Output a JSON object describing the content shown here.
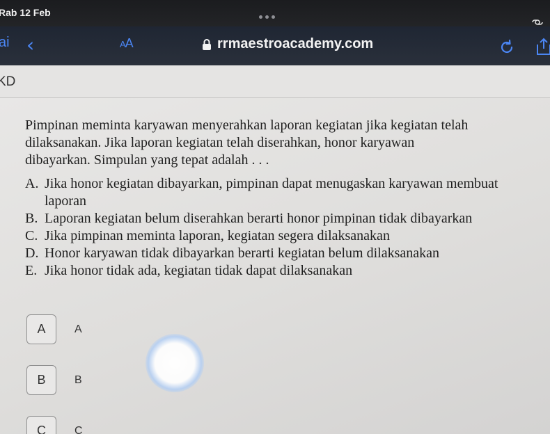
{
  "status_bar": {
    "time": "Rab 12 Feb"
  },
  "toolbar": {
    "tab_fragment": "ai",
    "text_size_label_small": "A",
    "text_size_label_large": "A",
    "url": "rrmaestroacademy.com"
  },
  "page": {
    "header_label": "KD",
    "question_lines": [
      "Pimpinan meminta karyawan menyerahkan laporan kegiatan jika kegiatan telah",
      "dilaksanakan. Jika laporan kegiatan telah diserahkan, honor karyawan",
      "dibayarkan. Simpulan yang tepat adalah . . ."
    ],
    "options": [
      {
        "letter": "A.",
        "text": "Jika honor kegiatan dibayarkan, pimpinan dapat menugaskan karyawan membuat laporan"
      },
      {
        "letter": "B.",
        "text": "Laporan kegiatan belum diserahkan berarti honor pimpinan tidak dibayarkan"
      },
      {
        "letter": "C.",
        "text": "Jika pimpinan meminta laporan, kegiatan segera dilaksanakan"
      },
      {
        "letter": "D.",
        "text": "Honor karyawan tidak dibayarkan berarti kegiatan belum dilaksanakan"
      },
      {
        "letter": "E.",
        "text": "Jika honor tidak ada, kegiatan tidak dapat dilaksanakan"
      }
    ],
    "answers": [
      {
        "box": "A",
        "label": "A"
      },
      {
        "box": "B",
        "label": "B"
      },
      {
        "box": "C",
        "label": "C"
      }
    ]
  },
  "icons": {
    "lock": "lock-icon",
    "reload": "reload-icon",
    "share": "share-icon",
    "back": "chevron-left-icon"
  },
  "colors": {
    "accent": "#4b86f4",
    "toolbar_bg": "#252b36",
    "page_bg": "#e5e4e3"
  }
}
